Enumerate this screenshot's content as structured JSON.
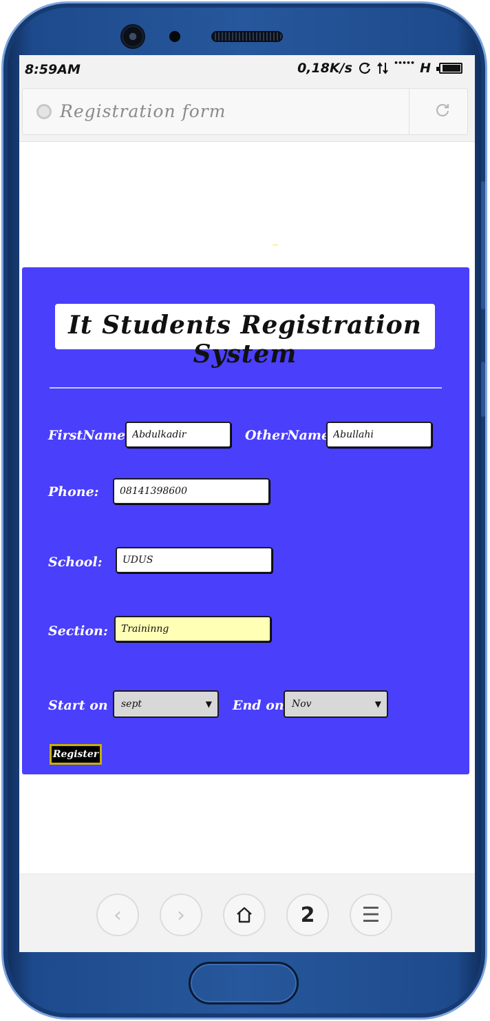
{
  "status_bar": {
    "time": "8:59AM",
    "network_speed": "0,18K/s",
    "signal_dots": "•••••",
    "network_type": "H"
  },
  "browser": {
    "page_title": "Registration form",
    "tab_count": "2"
  },
  "form": {
    "heading": "It Students Registration System",
    "firstname_label": "FirstName:",
    "firstname_value": "Abdulkadir",
    "othername_label": "OtherName:",
    "othername_value": "Abullahi",
    "phone_label": "Phone:",
    "phone_value": "08141398600",
    "school_label": "School:",
    "school_value": "UDUS",
    "section_label": "Section:",
    "section_value": "Traininng",
    "start_label": "Start on",
    "start_value": "sept",
    "end_label": "End on",
    "end_value": "Nov",
    "register_label": "Register"
  },
  "colors": {
    "panel": "#4a3ffb",
    "section_field": "#ffffb5",
    "register_border": "#c9b000",
    "phone_frame": "#27579c"
  },
  "icons": [
    "globe-icon",
    "reload-icon",
    "back-icon",
    "forward-icon",
    "home-icon",
    "menu-icon",
    "battery-icon",
    "sync-icon",
    "data-arrows-icon"
  ]
}
